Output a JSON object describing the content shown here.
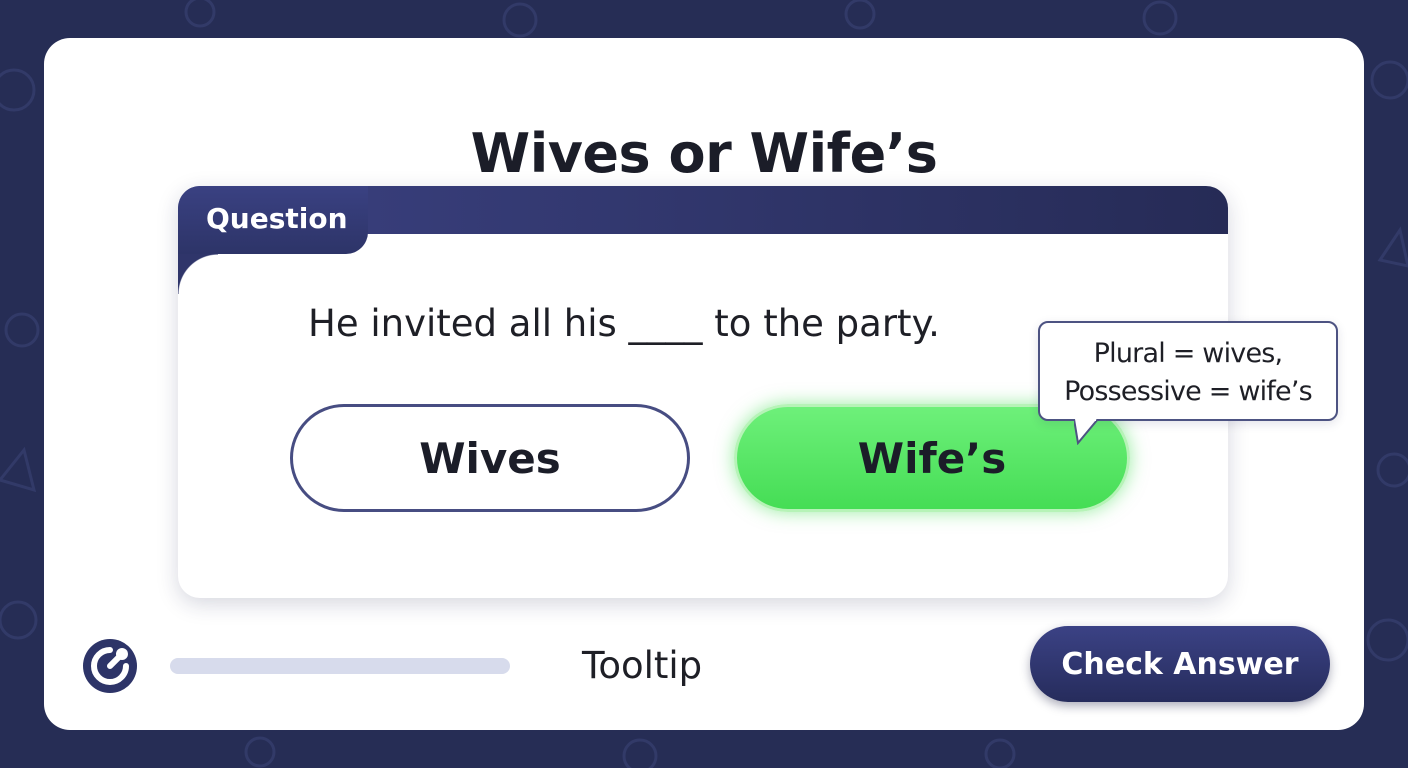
{
  "title": "Wives or Wife’s",
  "question_tab": "Question",
  "question": "He invited all his ____ to the party.",
  "options": [
    {
      "label": "Wives",
      "state": "unselected"
    },
    {
      "label": "Wife’s",
      "state": "highlighted"
    }
  ],
  "tooltip": {
    "line1": "Plural = wives,",
    "line2": "Possessive = wife’s"
  },
  "footer": {
    "tooltip_label": "Tooltip",
    "check_button": "Check Answer"
  },
  "colors": {
    "background": "#262d55",
    "accent_navy": "#2d3468",
    "option_green": "#45dd55"
  },
  "icons": [
    "logo-icon",
    "tooltip-tail-icon"
  ]
}
